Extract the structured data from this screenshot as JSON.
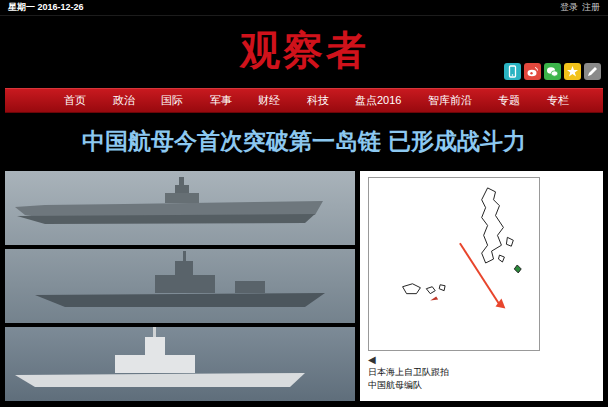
{
  "top_bar": {
    "date": "星期一 2016-12-26",
    "links": [
      "登录",
      "注册"
    ]
  },
  "logo": "观察者",
  "share_buttons": [
    {
      "kind": "phone",
      "color": "#2ab3c2"
    },
    {
      "kind": "weibo",
      "color": "#e2483d"
    },
    {
      "kind": "wechat",
      "color": "#3cb44a"
    },
    {
      "kind": "star",
      "color": "#f2c21b"
    },
    {
      "kind": "pencil",
      "color": "#8a8a8a"
    }
  ],
  "nav": {
    "items": [
      {
        "label": "首页",
        "selected": false
      },
      {
        "label": "政治",
        "selected": false
      },
      {
        "label": "国际",
        "selected": false
      },
      {
        "label": "军事",
        "selected": false
      },
      {
        "label": "财经",
        "selected": false
      },
      {
        "label": "科技",
        "selected": false
      },
      {
        "label": "盘点2016",
        "selected": false
      },
      {
        "label": "智库前沿",
        "selected": false
      },
      {
        "label": "专题",
        "selected": false
      },
      {
        "label": "专栏",
        "selected": false
      }
    ]
  },
  "headline": "中国航母今首次突破第一岛链 已形成战斗力",
  "gallery": {
    "prev": "◀",
    "caption": [
      "日本海上自卫队跟拍",
      "中国航母编队"
    ]
  }
}
